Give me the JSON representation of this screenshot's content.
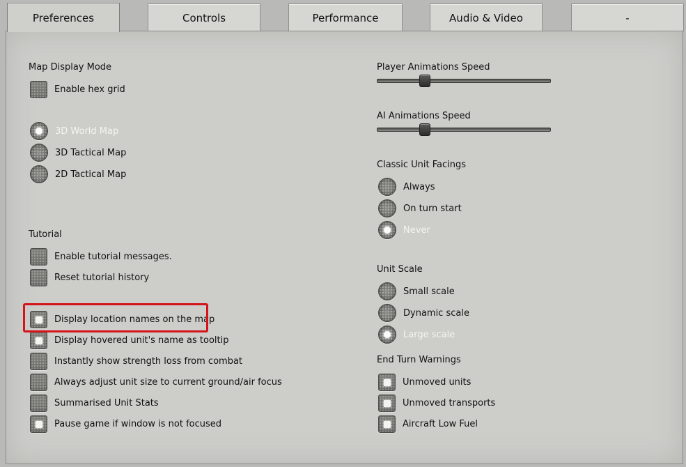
{
  "tabs": [
    {
      "label": "Preferences"
    },
    {
      "label": "Controls"
    },
    {
      "label": "Performance"
    },
    {
      "label": "Audio & Video"
    },
    {
      "label": "-"
    }
  ],
  "map_display": {
    "heading": "Map Display Mode",
    "hex_grid": {
      "label": "Enable hex grid",
      "checked": false
    },
    "modes": [
      {
        "label": "3D World Map",
        "selected": true
      },
      {
        "label": "3D Tactical Map",
        "selected": false
      },
      {
        "label": "2D Tactical Map",
        "selected": false
      }
    ]
  },
  "tutorial": {
    "heading": "Tutorial",
    "items": [
      {
        "label": "Enable tutorial messages.",
        "checked": false
      },
      {
        "label": "Reset tutorial history",
        "checked": false
      }
    ]
  },
  "general_options": [
    {
      "label": "Display location names on the map",
      "checked": true
    },
    {
      "label": "Display hovered unit's name as tooltip",
      "checked": true
    },
    {
      "label": "Instantly show strength loss from combat",
      "checked": false
    },
    {
      "label": "Always adjust unit size to current ground/air focus",
      "checked": false
    },
    {
      "label": "Summarised Unit Stats",
      "checked": false
    },
    {
      "label": "Pause game if window is not focused",
      "checked": true
    }
  ],
  "player_anim": {
    "heading": "Player Animations Speed",
    "value": 0.26
  },
  "ai_anim": {
    "heading": "AI Animations Speed",
    "value": 0.26
  },
  "facings": {
    "heading": "Classic Unit Facings",
    "options": [
      {
        "label": "Always",
        "selected": false
      },
      {
        "label": "On turn start",
        "selected": false
      },
      {
        "label": "Never",
        "selected": true
      }
    ]
  },
  "unit_scale": {
    "heading": "Unit Scale",
    "options": [
      {
        "label": "Small scale",
        "selected": false
      },
      {
        "label": "Dynamic scale",
        "selected": false
      },
      {
        "label": "Large scale",
        "selected": true
      }
    ]
  },
  "end_turn": {
    "heading": "End Turn Warnings",
    "items": [
      {
        "label": "Unmoved units",
        "checked": true
      },
      {
        "label": "Unmoved transports",
        "checked": true
      },
      {
        "label": "Aircraft Low Fuel",
        "checked": true
      }
    ]
  },
  "colors": {
    "highlight": "#d3151b",
    "selected_text": "#f4f4f0"
  }
}
